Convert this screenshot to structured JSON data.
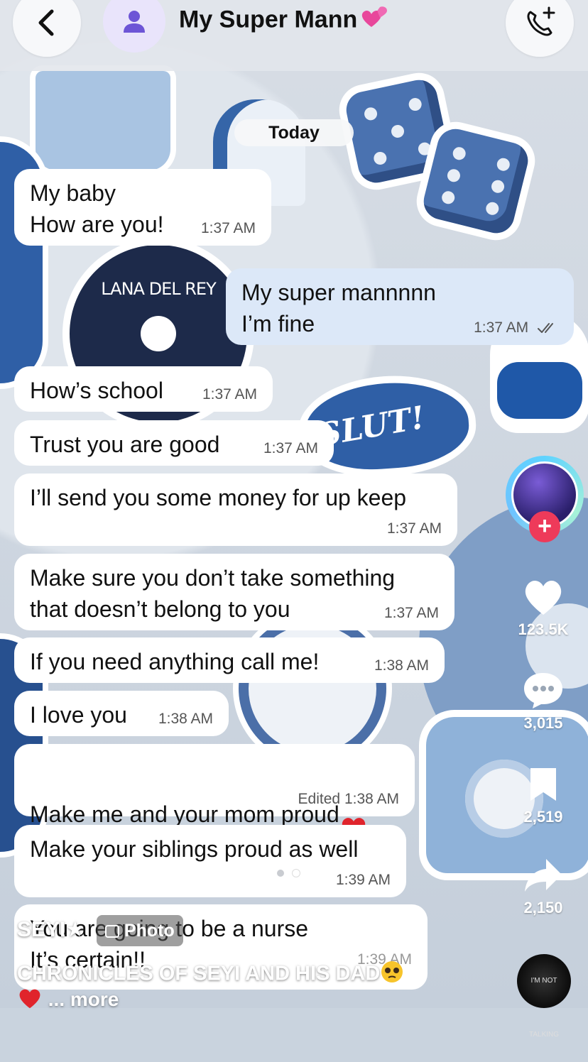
{
  "header": {
    "title": "My Super Mann",
    "title_emoji": "heart-sparkle-icon"
  },
  "date_chip": "Today",
  "messages": [
    {
      "dir": "in",
      "text": "My baby\nHow are you!",
      "time": "1:37 AM"
    },
    {
      "dir": "out",
      "text": "My super mannnnn\nI’m fine",
      "time": "1:37 AM",
      "status": "read-double-check"
    },
    {
      "dir": "in",
      "text": "How’s school",
      "time": "1:37 AM"
    },
    {
      "dir": "in",
      "text": "Trust you are good",
      "time": "1:37 AM"
    },
    {
      "dir": "in",
      "text": "I’ll send you some money for up keep",
      "time": "1:37 AM"
    },
    {
      "dir": "in",
      "text": "Make sure you don’t take something\nthat doesn’t belong to you",
      "time": "1:37 AM"
    },
    {
      "dir": "in",
      "text": "If you need anything call me!",
      "time": "1:38 AM"
    },
    {
      "dir": "in",
      "text": "I love you",
      "time": "1:38 AM"
    },
    {
      "dir": "in",
      "text": "Make me and your mom proud",
      "time": "1:38 AM",
      "emoji": "red-heart-icon",
      "edited_label": "Edited"
    },
    {
      "dir": "in",
      "text": "Make your siblings proud as well",
      "time": "1:39 AM"
    },
    {
      "dir": "in",
      "text": "You are going to be a nurse\nIt’s certain!!",
      "time": "1:39 AM"
    }
  ],
  "stickers": {
    "record_label": "LANA DEL REY",
    "lips_label": "SLUT!"
  },
  "tiktok": {
    "likes": "123.5K",
    "comments": "3,015",
    "saves": "2,519",
    "shares": "2,150",
    "author": "SEYI★",
    "photo_label": "Photo",
    "caption": "CHRONICLES OF SEYI AND HIS DAD",
    "more_label": "... more",
    "music_label": "I'M NOT TALKING"
  },
  "colors": {
    "incoming_bubble": "#ffffff",
    "outgoing_bubble": "#dce8f8",
    "avatar_bg": "#e9e4fb",
    "avatar_icon": "#6d55d6",
    "follow_plus": "#ee3a5a"
  }
}
